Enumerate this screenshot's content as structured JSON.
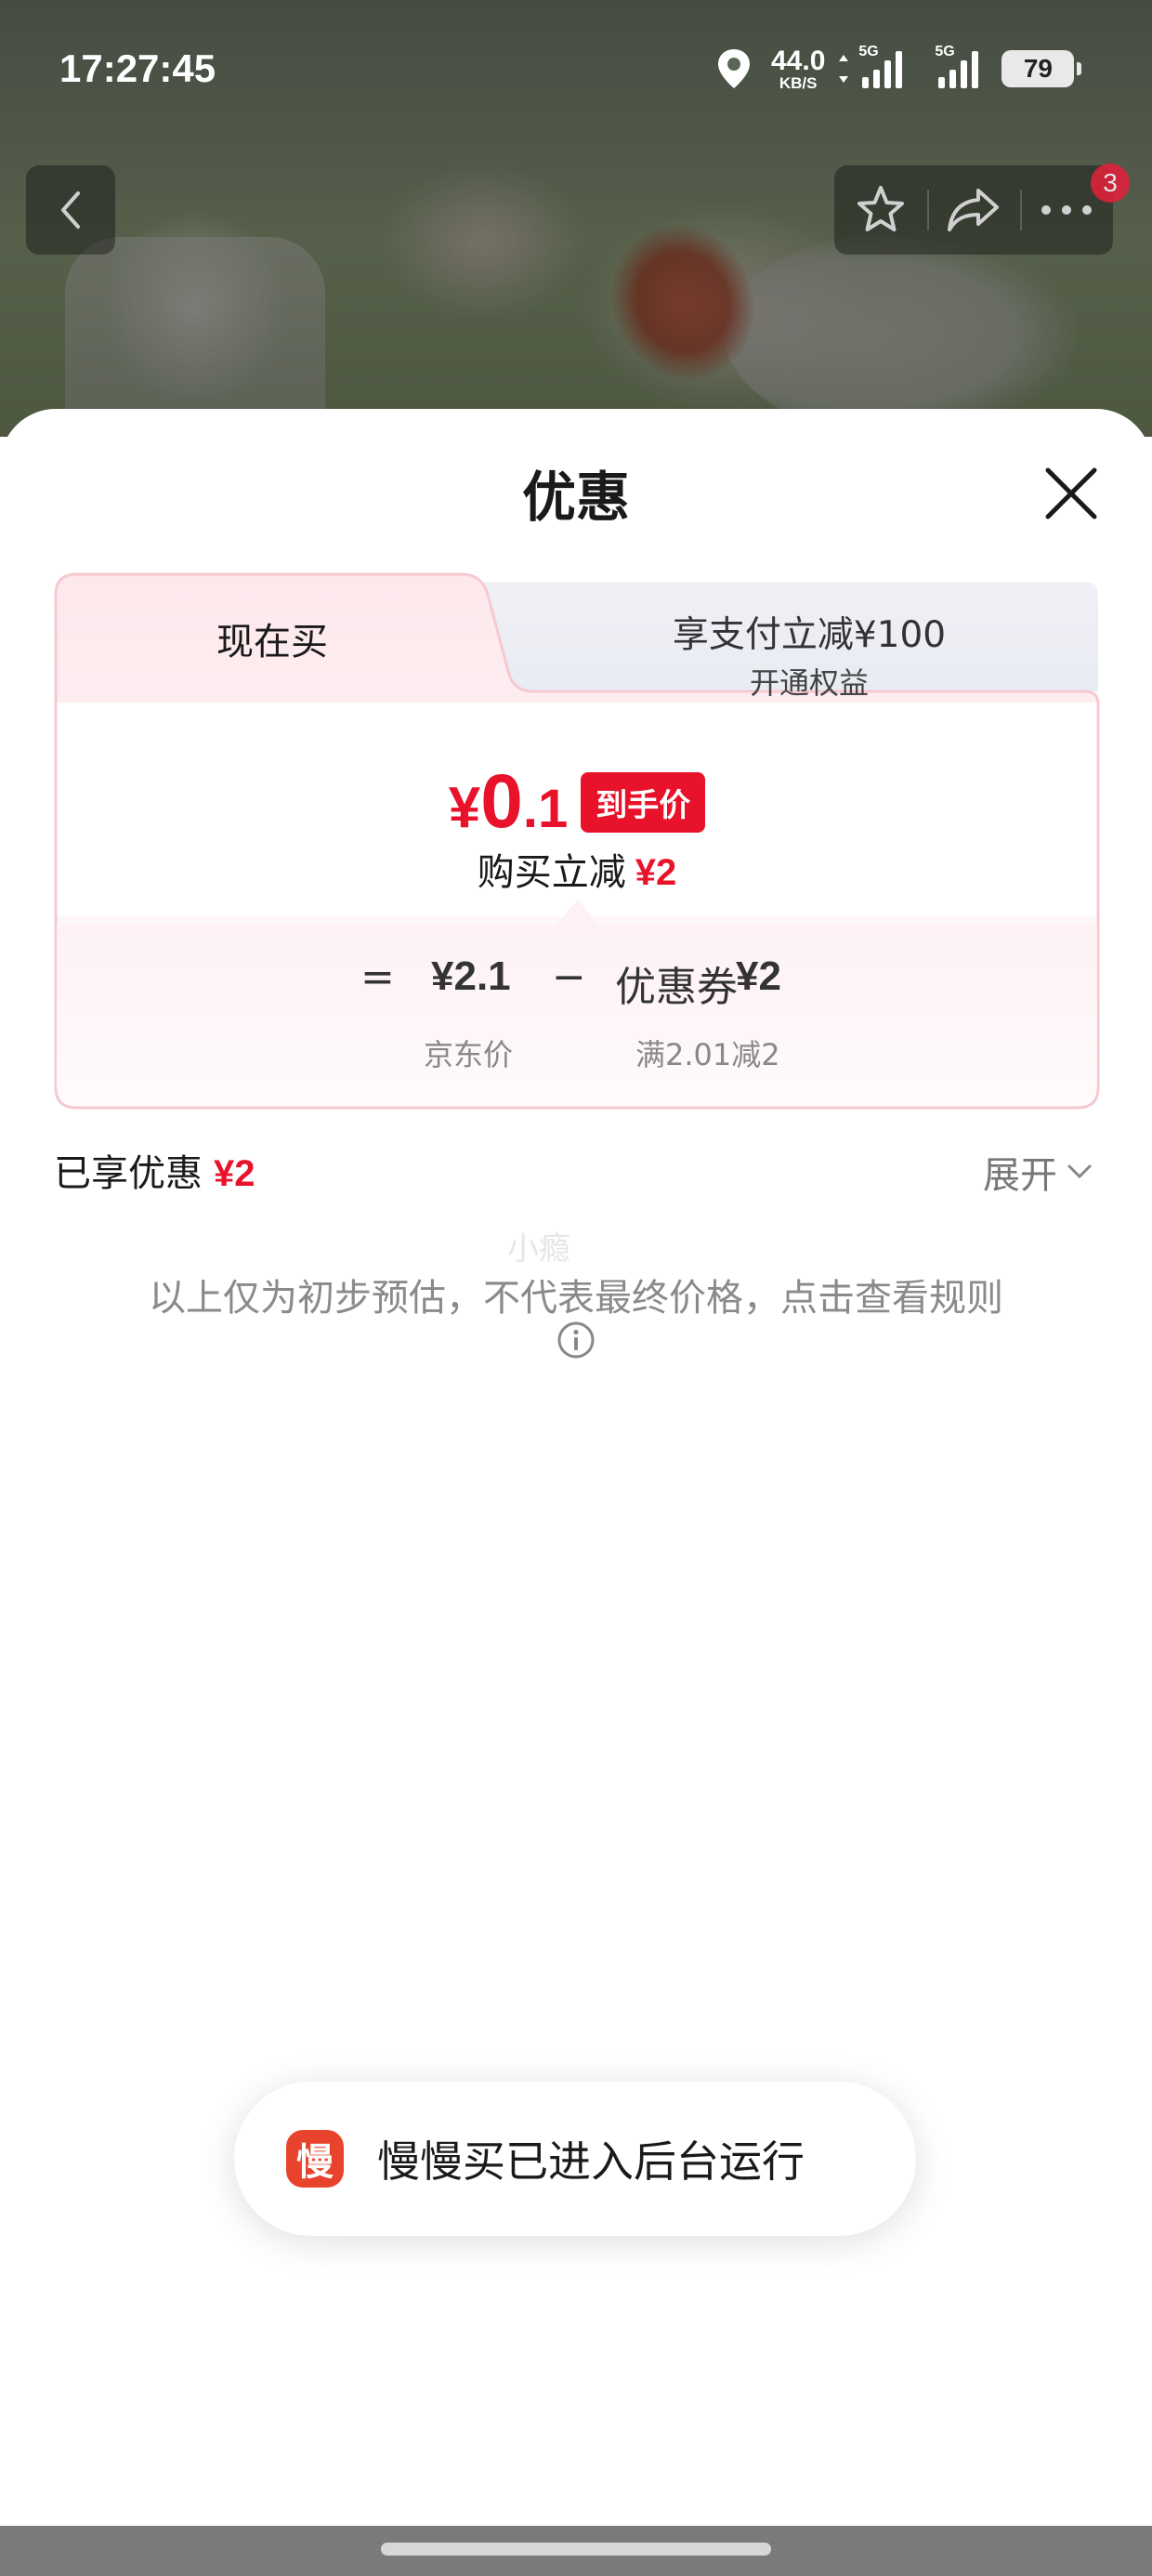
{
  "status_bar": {
    "time": "17:27:45",
    "net_speed": "44.0",
    "net_unit": "KB/S",
    "signal1_label": "5G",
    "signal2_label": "5G",
    "battery": "79"
  },
  "nav": {
    "badge_count": "3",
    "icons": [
      "back-icon",
      "star-icon",
      "share-icon",
      "more-icon"
    ]
  },
  "sheet": {
    "title": "优惠"
  },
  "card": {
    "tab_now": "现在买",
    "tab_pay_title": "享支付立减¥100",
    "tab_pay_sub": "开通权益",
    "price_yen": "¥",
    "price_int": "0",
    "price_dec": ".1",
    "price_tag": "到手价",
    "reduce_label": "购买立减",
    "reduce_amount": "¥2",
    "formula": {
      "eq": "=",
      "price": "¥2.1",
      "minus": "−",
      "coupon_label": "优惠券",
      "coupon_amount": "¥2",
      "price_label": "京东价",
      "coupon_condition": "满2.01减2"
    }
  },
  "enjoyed": {
    "label": "已享优惠",
    "amount": "¥2",
    "expand_label": "展开"
  },
  "watermark": "小瘾",
  "disclaimer": "以上仅为初步预估，不代表最终价格，点击查看规则",
  "toast": {
    "icon_char": "慢",
    "text": "慢慢买已进入后台运行"
  },
  "colors": {
    "accent_red": "#e8132b",
    "toast_icon": "#e8442d",
    "card_border": "#f6c9d1"
  }
}
